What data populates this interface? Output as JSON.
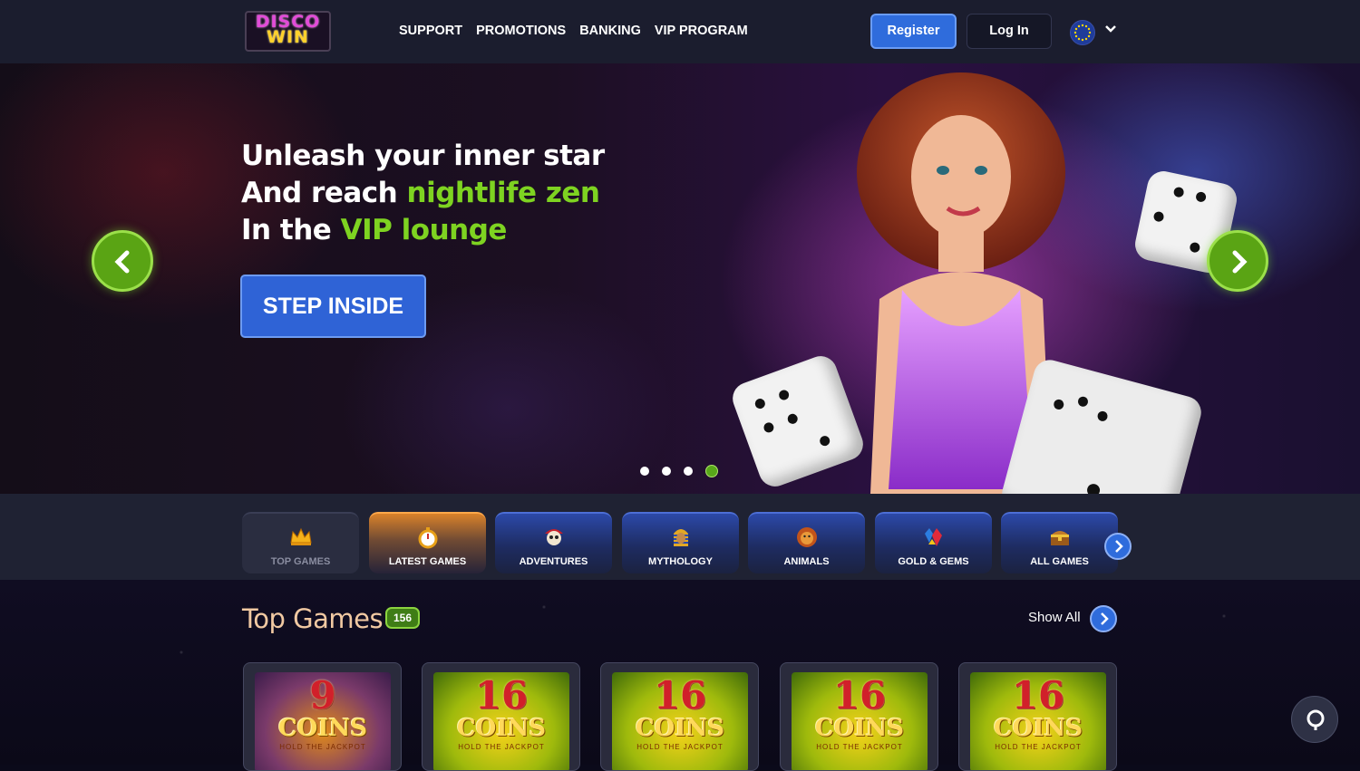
{
  "brand": {
    "logo_line1": "DISCO",
    "logo_line2": "WIN"
  },
  "nav": {
    "items": [
      "SUPPORT",
      "PROMOTIONS",
      "BANKING",
      "VIP PROGRAM"
    ]
  },
  "auth": {
    "register_label": "Register",
    "login_label": "Log In"
  },
  "language": {
    "icon": "eu-flag-icon"
  },
  "hero": {
    "line1": "Unleash your inner star",
    "line2_prefix": "And reach ",
    "line2_highlight": "nightlife zen",
    "line3_prefix": "In the ",
    "line3_highlight": "VIP lounge",
    "cta_label": "STEP INSIDE",
    "slide_count": 4,
    "active_slide": 4,
    "highlight_color": "#7ed321"
  },
  "categories": [
    {
      "label": "TOP GAMES",
      "icon": "crown-icon"
    },
    {
      "label": "LATEST GAMES",
      "icon": "stopwatch-icon"
    },
    {
      "label": "ADVENTURES",
      "icon": "pirate-skull-icon"
    },
    {
      "label": "MYTHOLOGY",
      "icon": "pharaoh-icon"
    },
    {
      "label": "ANIMALS",
      "icon": "lion-icon"
    },
    {
      "label": "GOLD & GEMS",
      "icon": "gems-icon"
    },
    {
      "label": "ALL GAMES",
      "icon": "treasure-chest-icon"
    }
  ],
  "top_games": {
    "title": "Top Games",
    "count": "156",
    "show_all_label": "Show All",
    "games": [
      {
        "number": "9",
        "name": "COINS",
        "sub": "HOLD THE JACKPOT"
      },
      {
        "number": "16",
        "name": "COINS",
        "sub": "HOLD THE JACKPOT"
      },
      {
        "number": "16",
        "name": "COINS",
        "sub": "HOLD THE JACKPOT"
      },
      {
        "number": "16",
        "name": "COINS",
        "sub": "HOLD THE JACKPOT"
      },
      {
        "number": "16",
        "name": "COINS",
        "sub": "HOLD THE JACKPOT"
      }
    ]
  },
  "colors": {
    "primary_blue": "#2f6cdc",
    "accent_green": "#7ed321",
    "header_bg": "#1b1d2e"
  }
}
